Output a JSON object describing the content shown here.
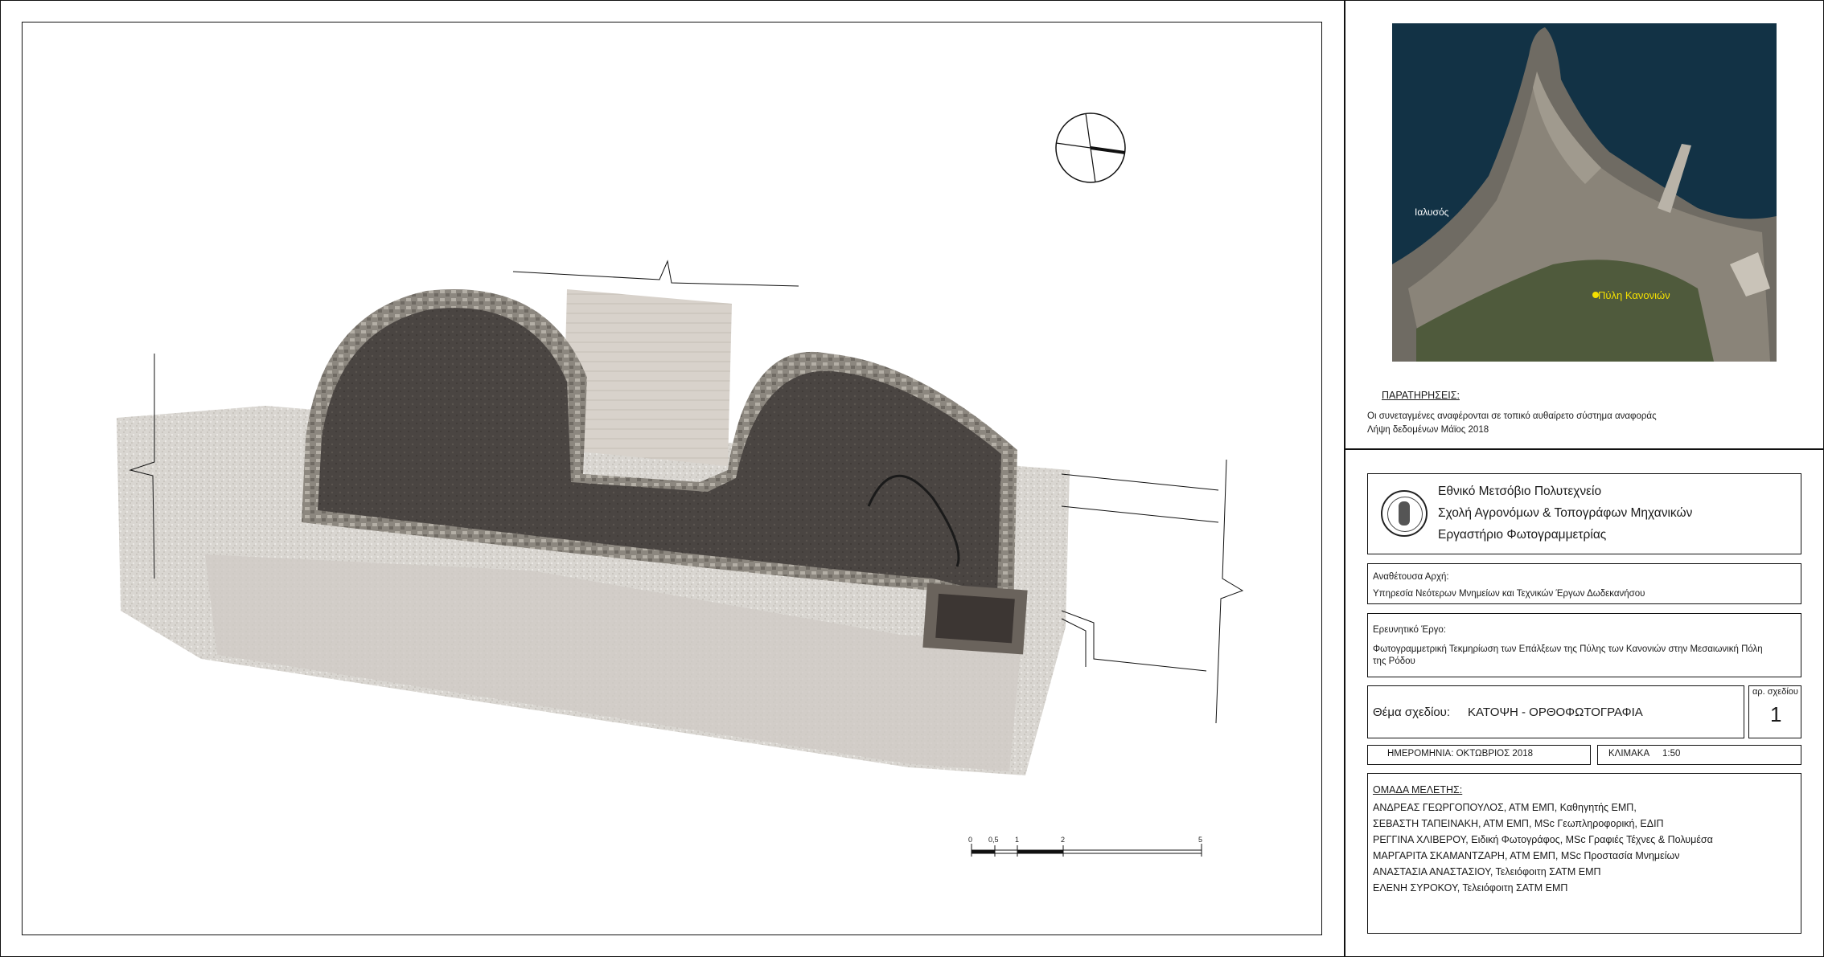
{
  "map": {
    "label_ialysos": "Ιαλυσός",
    "label_site": "Πύλη Κανονιών"
  },
  "notes": {
    "heading": "ΠΑΡΑΤΗΡΗΣΕΙΣ:",
    "line1": "Οι συνεταγμένες αναφέρονται σε τοπικό αυθαίρετο σύστημα αναφοράς",
    "line2": "Λήψη δεδομένων Μάϊος 2018"
  },
  "institution": {
    "line1": "Εθνικό Μετσόβιο Πολυτεχνείο",
    "line2": "Σχολή Αγρονόμων & Τοπογράφων Μηχανικών",
    "line3": "Εργαστήριο Φωτογραμμετρίας"
  },
  "authority": {
    "label": "Αναθέτουσα Αρχή:",
    "value": "Υπηρεσία Νεότερων Μνημείων και Τεχνικών Έργων Δωδεκανήσου"
  },
  "project": {
    "label": "Ερευνητικό Έργο:",
    "value_line1": "Φωτογραμμετρική Τεκμηρίωση των Επάλξεων της Πύλης των Κανονιών στην Μεσαιωνική Πόλη",
    "value_line2": "της Ρόδου"
  },
  "drawing": {
    "subject_label": "Θέμα σχεδίου:",
    "subject_value": "ΚΑΤΟΨΗ - ΟΡΘΟΦΩΤΟΓΡΑΦΙΑ",
    "number_label": "αρ. σχεδίου",
    "number_value": "1",
    "date_text": "ΗΜΕΡΟΜΗΝΙΑ: ΟΚΤΩΒΡΙΟΣ 2018",
    "scale_label": "ΚΛΙΜΑΚΑ",
    "scale_value": "1:50"
  },
  "scale_bar": {
    "ticks": [
      "0",
      "0,5",
      "1",
      "2",
      "5"
    ]
  },
  "team": {
    "heading": "ΟΜΑΔΑ ΜΕΛΕΤΗΣ:",
    "members": [
      "ΑΝΔΡΕΑΣ   ΓΕΩΡΓΟΠΟΥΛΟΣ, ΑΤΜ ΕΜΠ, Καθηγητής ΕΜΠ,",
      "ΣΕΒΑΣΤΗ ΤΑΠΕΙΝΑΚΗ, ΑΤΜ ΕΜΠ, MSc Γεωπληροφορική, ΕΔΙΠ",
      "ΡΕΓΓΙΝΑ ΧΛΙΒΕΡΟΥ, Ειδική Φωτογράφος, MSc Γραφιές Τέχνες & Πολυμέσα",
      "ΜΑΡΓΑΡΙΤΑ ΣΚΑΜΑΝΤΖΑΡΗ,  ΑΤΜ ΕΜΠ, MSc Προστασία Μνημείων",
      "ΑΝΑΣΤΑΣΙΑ ΑΝΑΣΤΑΣΙΟΥ, Τελειόφοιτη ΣΑΤΜ ΕΜΠ",
      "ΕΛΕΝΗ ΣΥΡΟΚΟΥ, Τελειόφοιτη ΣΑΤΜ ΕΜΠ"
    ]
  }
}
